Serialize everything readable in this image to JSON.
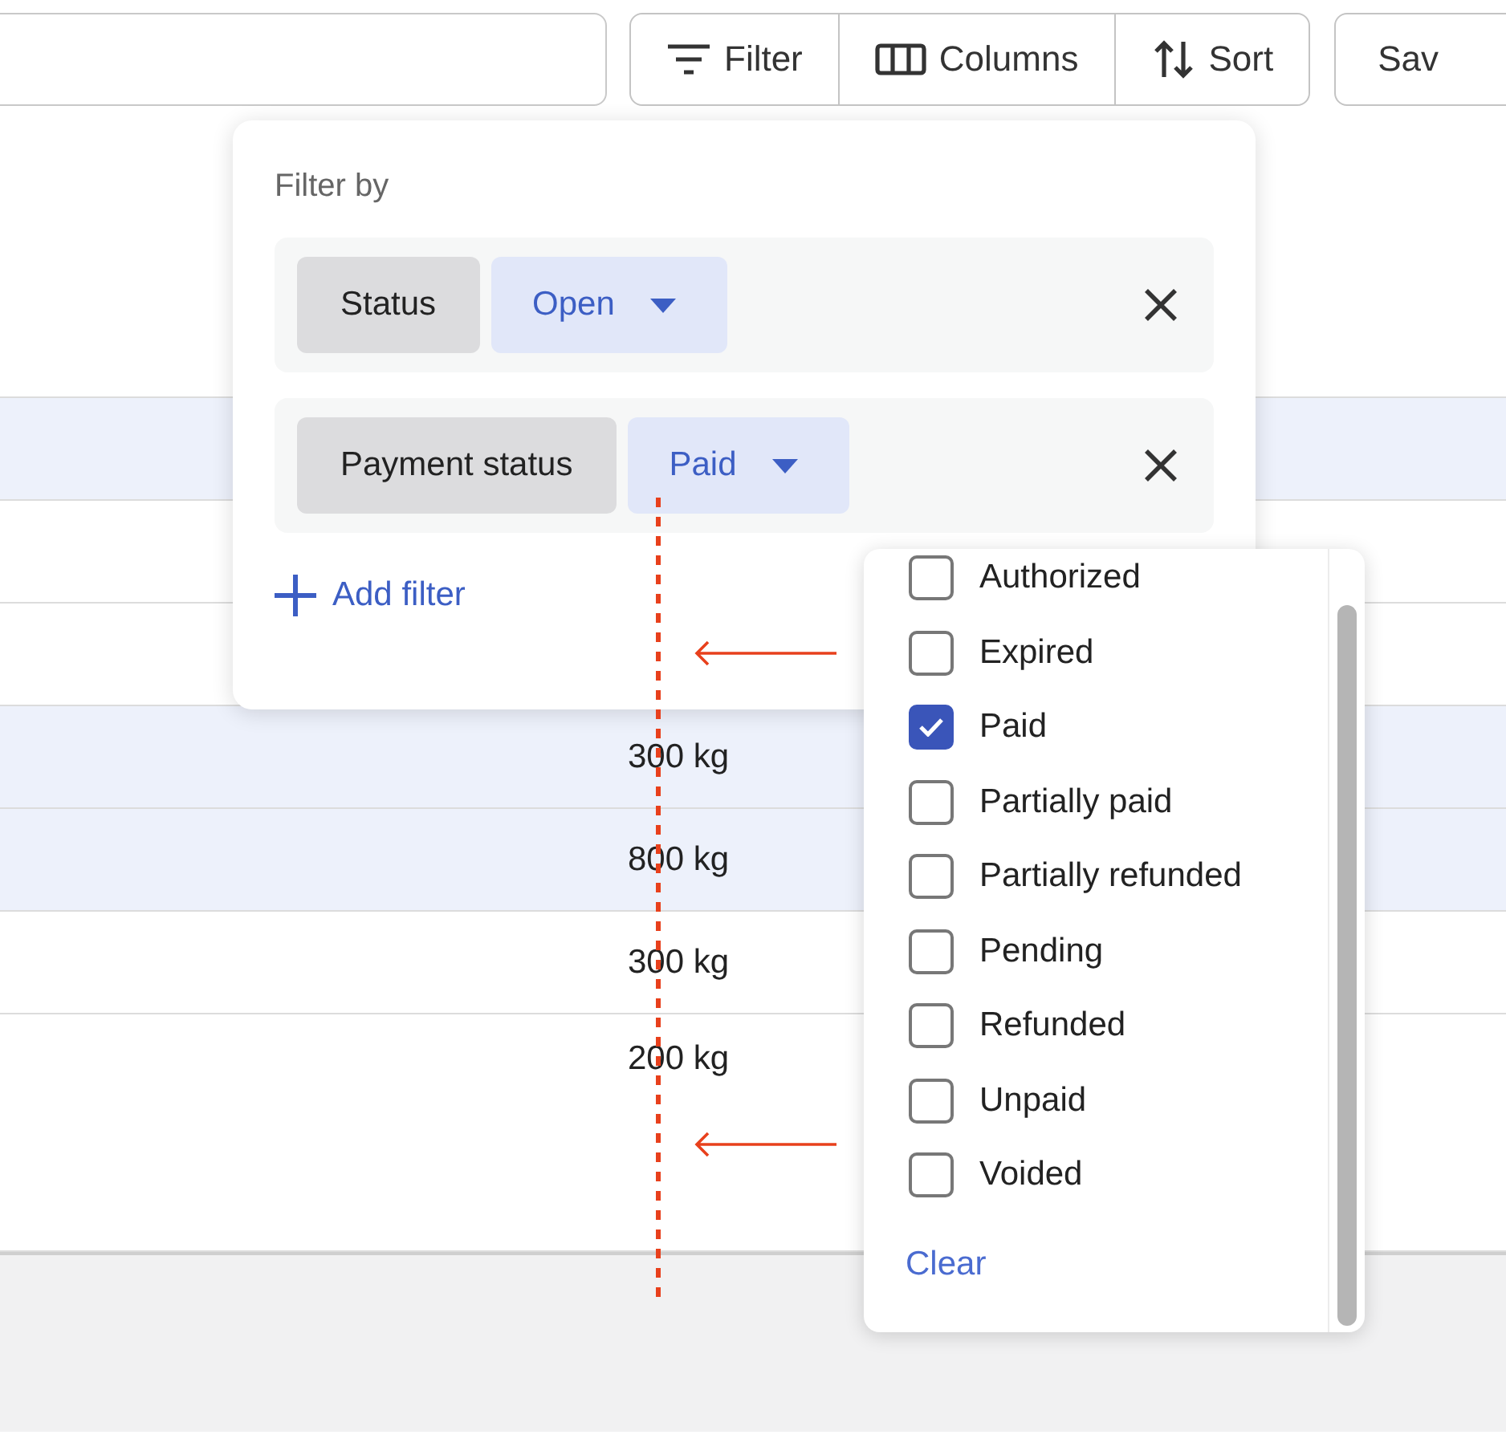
{
  "toolbar": {
    "buttons": [
      {
        "label": "Filter",
        "kind": "filter"
      },
      {
        "label": "Columns",
        "kind": "columns"
      },
      {
        "label": "Sort",
        "kind": "sort"
      }
    ],
    "save_button": {
      "label": "Sav"
    }
  },
  "table": {
    "rows": [
      {
        "selected": true
      },
      {
        "selected": false
      },
      {
        "selected": false
      },
      {
        "weight": "300 kg",
        "selected": true
      },
      {
        "weight": "800 kg",
        "selected": true
      },
      {
        "weight": "300 kg",
        "selected": false
      },
      {
        "weight": "200 kg",
        "selected": false
      }
    ]
  },
  "filter_panel": {
    "title": "Filter by",
    "filters": [
      {
        "field": "Status",
        "value": "Open"
      },
      {
        "field": "Payment status",
        "value": "Paid"
      }
    ],
    "add_label": "Add filter"
  },
  "dropdown": {
    "options": [
      {
        "label": "Authorized",
        "checked": false
      },
      {
        "label": "Expired",
        "checked": false
      },
      {
        "label": "Paid",
        "checked": true
      },
      {
        "label": "Partially paid",
        "checked": false
      },
      {
        "label": "Partially refunded",
        "checked": false
      },
      {
        "label": "Pending",
        "checked": false
      },
      {
        "label": "Refunded",
        "checked": false
      },
      {
        "label": "Unpaid",
        "checked": false
      },
      {
        "label": "Voided",
        "checked": false
      }
    ],
    "clear_label": "Clear"
  },
  "annotations": [
    {
      "kind": "dotted-line"
    },
    {
      "kind": "arrow"
    },
    {
      "kind": "arrow"
    }
  ]
}
